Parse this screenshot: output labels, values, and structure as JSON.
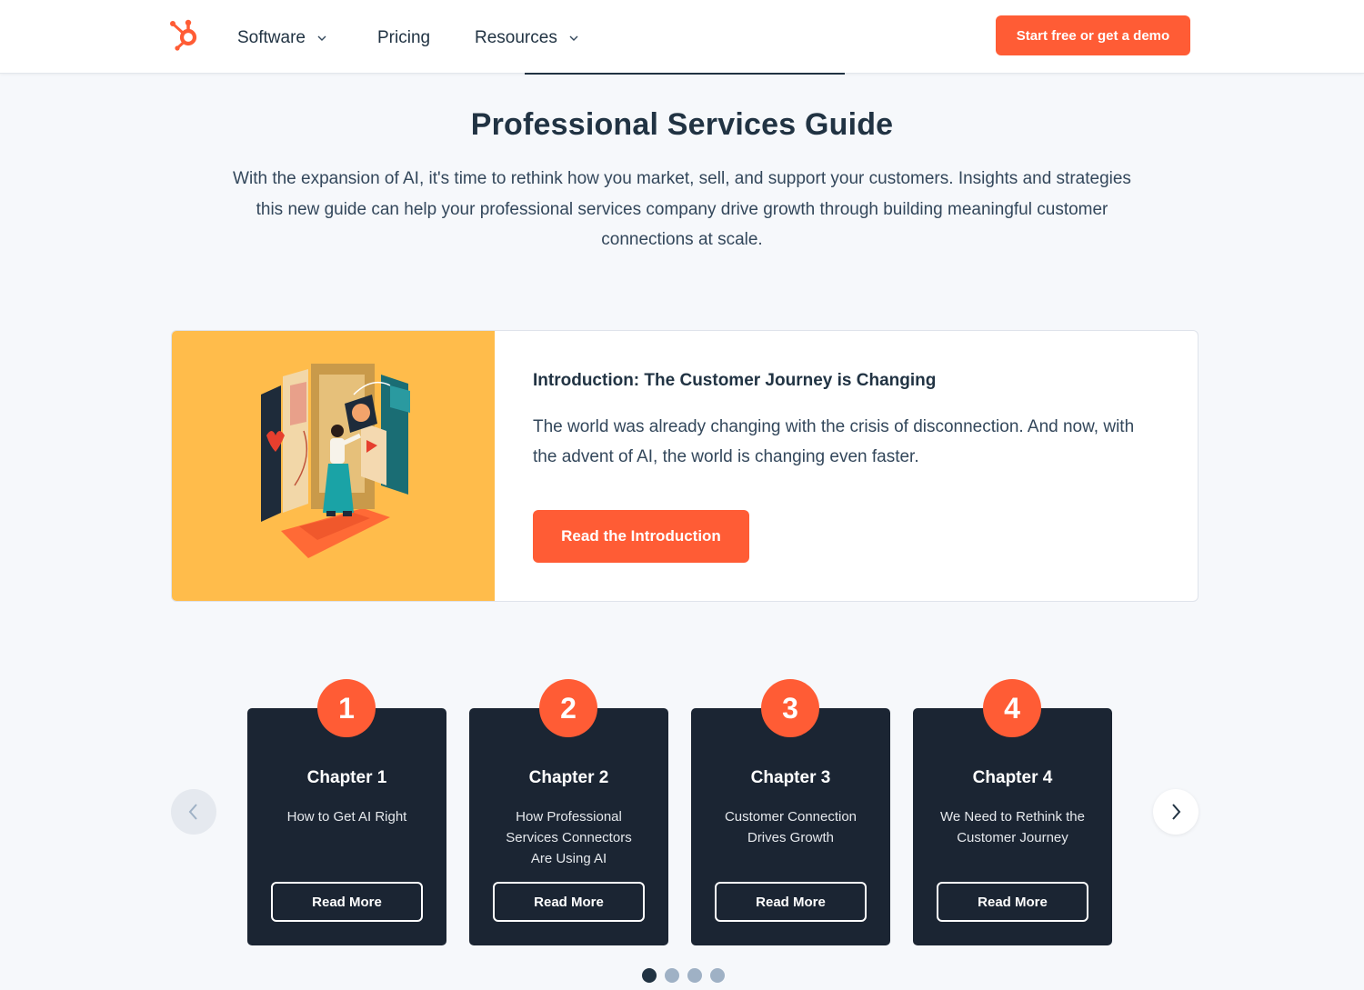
{
  "header": {
    "logo_icon": "hubspot-sprocket-icon",
    "nav": [
      {
        "label": "Software",
        "has_dropdown": true
      },
      {
        "label": "Pricing",
        "has_dropdown": false
      },
      {
        "label": "Resources",
        "has_dropdown": true
      }
    ],
    "cta_label": "Start free or get a demo"
  },
  "hero": {
    "title": "Professional Services Guide",
    "intro": "With the expansion of AI, it's time to rethink how you market, sell, and support your customers. Insights and strategies this new guide can help your professional services company drive growth through building meaningful customer connections at scale."
  },
  "intro_card": {
    "heading": "Introduction: The Customer Journey is Changing",
    "text": "The world was already changing with the crisis of disconnection. And now, with the advent of AI, the world is changing even faster.",
    "button_label": "Read the Introduction",
    "image_icon": "customer-journey-illustration"
  },
  "chapters": [
    {
      "number": "1",
      "title": "Chapter 1",
      "subtitle": "How to Get AI Right",
      "button_label": "Read More"
    },
    {
      "number": "2",
      "title": "Chapter 2",
      "subtitle": "How Professional Services Connectors Are Using AI",
      "button_label": "Read More"
    },
    {
      "number": "3",
      "title": "Chapter 3",
      "subtitle": "Customer Connection Drives Growth",
      "button_label": "Read More"
    },
    {
      "number": "4",
      "title": "Chapter 4",
      "subtitle": "We Need to Rethink the Customer Journey",
      "button_label": "Read More"
    }
  ],
  "carousel": {
    "prev_icon": "chevron-left-icon",
    "next_icon": "chevron-right-icon",
    "page_count": 4,
    "active_page": 1
  },
  "colors": {
    "brand_orange": "#ff5c35",
    "navy": "#213343",
    "card_dark": "#1b2533",
    "intro_media_bg": "#ffbc4b",
    "page_bg": "#f6f8fb"
  }
}
